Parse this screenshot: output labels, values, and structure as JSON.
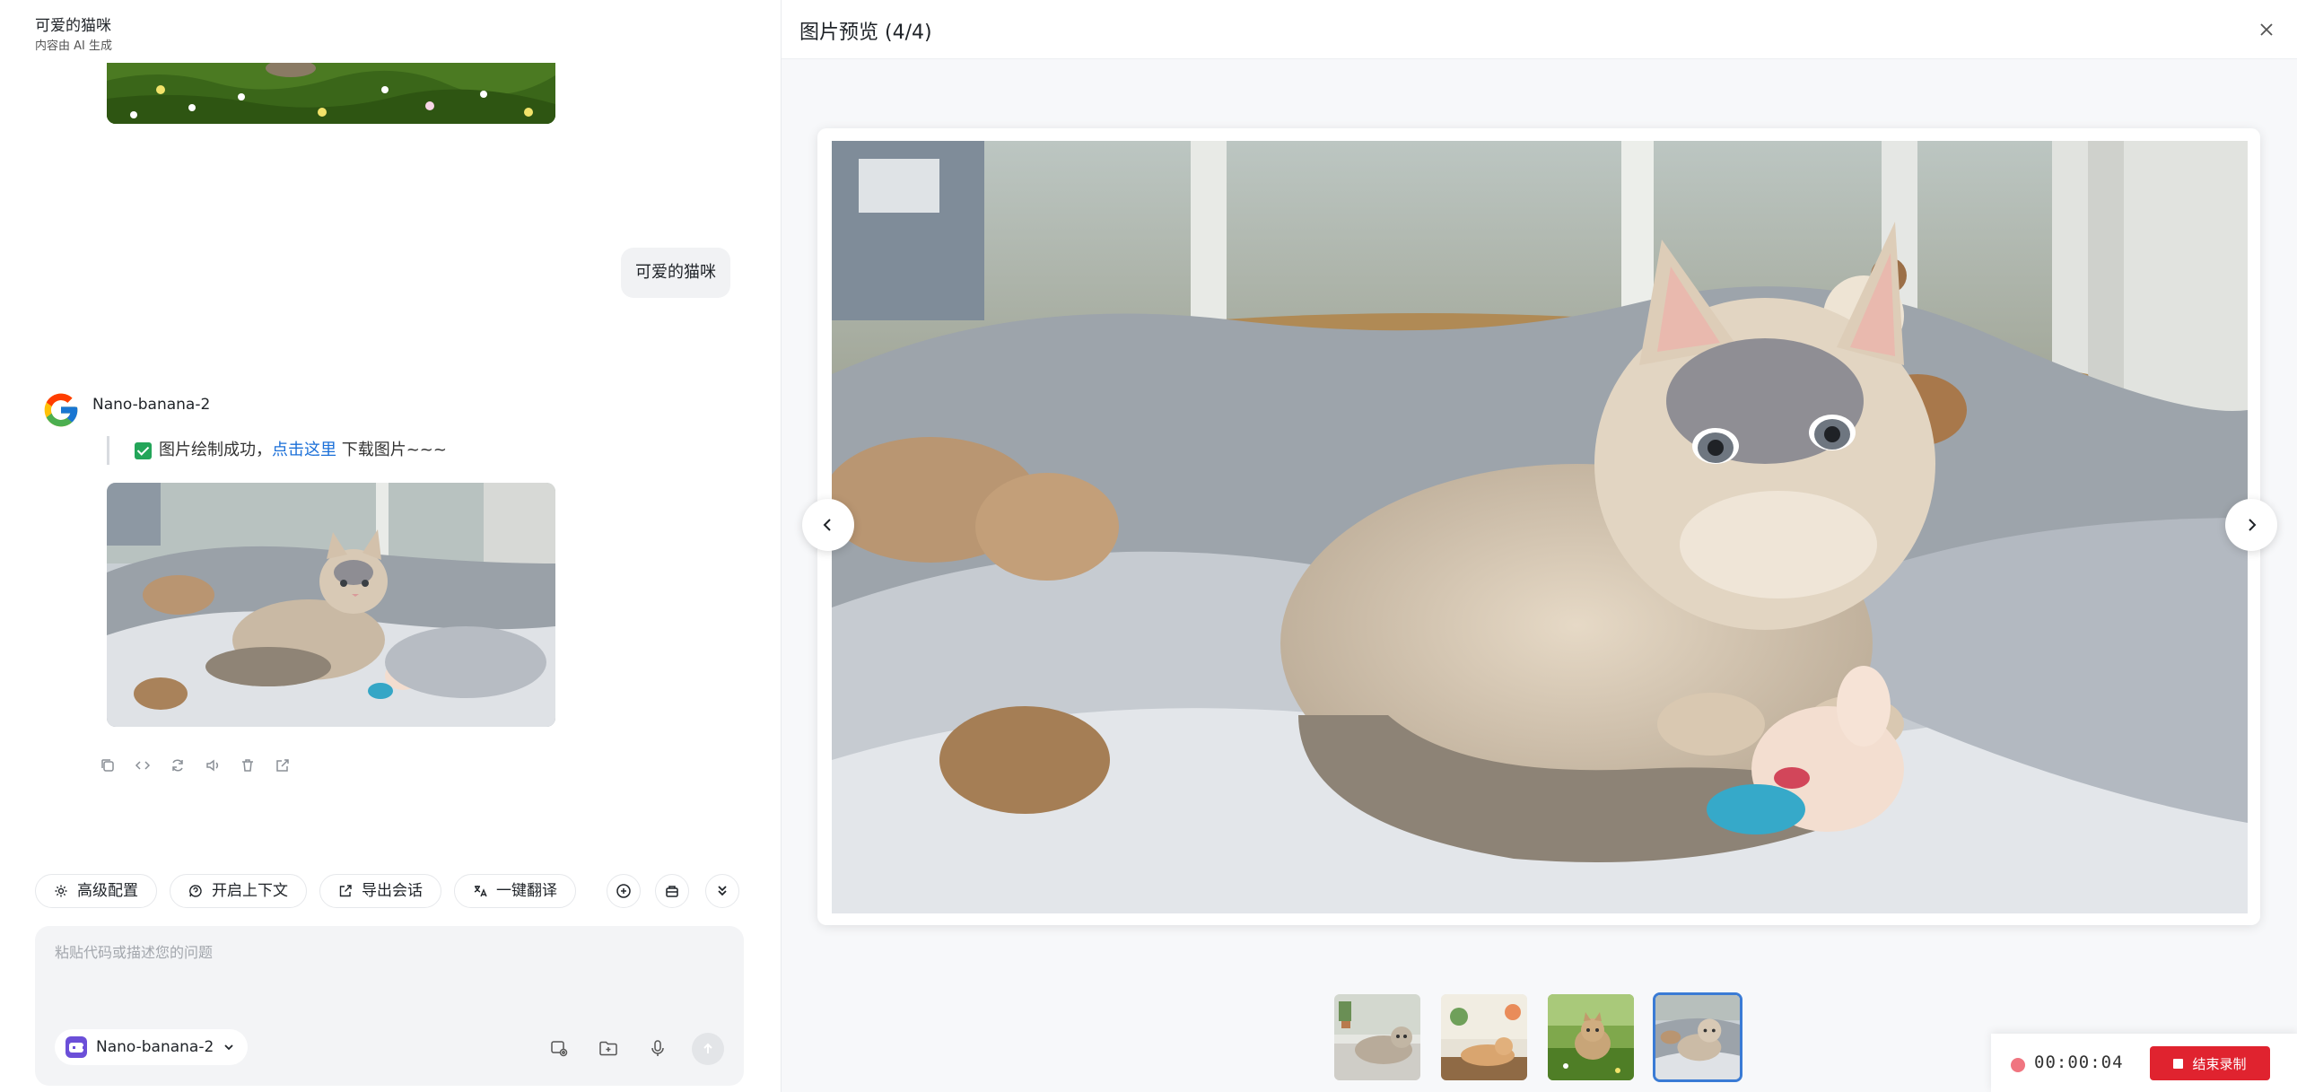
{
  "header": {
    "title": "可爱的猫咪",
    "subtitle": "内容由 AI 生成"
  },
  "chat": {
    "user_message": "可爱的猫咪",
    "model_name": "Nano-banana-2",
    "status_text": "图片绘制成功，",
    "link_text": "点击这里",
    "status_suffix": " 下载图片~~~"
  },
  "toolbar": {
    "chips": [
      "高级配置",
      "开启上下文",
      "导出会话",
      "一键翻译"
    ]
  },
  "composer": {
    "placeholder": "粘贴代码或描述您的问题",
    "selected_model": "Nano-banana-2"
  },
  "preview": {
    "title": "图片预览 (4/4)",
    "active_index": 4,
    "thumbnails": [
      "cat-on-window-cushion",
      "cat-on-table-with-flowers",
      "kitten-in-grass",
      "kitten-in-blanket-basket"
    ]
  },
  "recorder": {
    "time": "00:00:04",
    "stop_label": "结束录制"
  },
  "colors": {
    "accent": "#1a6fd8",
    "record_red": "#e0232f",
    "success_green": "#23a559"
  }
}
